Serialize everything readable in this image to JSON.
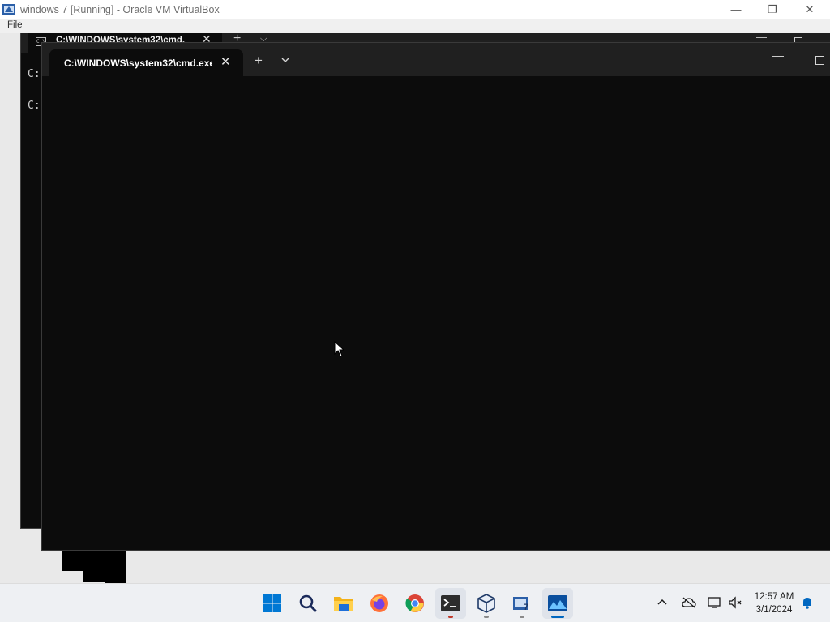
{
  "host_window": {
    "title": "windows 7 [Running] - Oracle VM VirtualBox",
    "menu_file": "File",
    "controls": {
      "minimize": "—",
      "restore": "❐",
      "close": "✕"
    }
  },
  "back_terminal": {
    "tab_title": "C:\\WINDOWS\\system32\\cmd.",
    "tab_icon": "C:\\",
    "tab_close": "✕",
    "new_tab": "+",
    "dropdown": "⌵",
    "minimize": "—",
    "lines": [
      "C:",
      "C:"
    ]
  },
  "front_terminal": {
    "tab_title": "C:\\WINDOWS\\system32\\cmd.exe",
    "tab_close": "✕",
    "new_tab": "+",
    "minimize": "—"
  },
  "taskbar": {
    "apps": [
      {
        "name": "start",
        "icon": "windows-logo-icon"
      },
      {
        "name": "search",
        "icon": "search-icon"
      },
      {
        "name": "file-explorer",
        "icon": "folder-icon"
      },
      {
        "name": "firefox",
        "icon": "firefox-icon"
      },
      {
        "name": "chrome",
        "icon": "chrome-icon"
      },
      {
        "name": "terminal",
        "icon": "terminal-icon"
      },
      {
        "name": "virtualbox",
        "icon": "virtualbox-icon"
      },
      {
        "name": "vm-windows7",
        "icon": "vm-icon"
      },
      {
        "name": "photos",
        "icon": "photos-icon"
      }
    ],
    "tray": {
      "chevron": "^",
      "time": "12:57 AM",
      "date": "3/1/2024"
    }
  },
  "colors": {
    "terminal_bg": "#0c0c0c",
    "tabbar_bg": "#202020",
    "taskbar_bg": "#eef0f3",
    "accent": "#0067c0"
  }
}
